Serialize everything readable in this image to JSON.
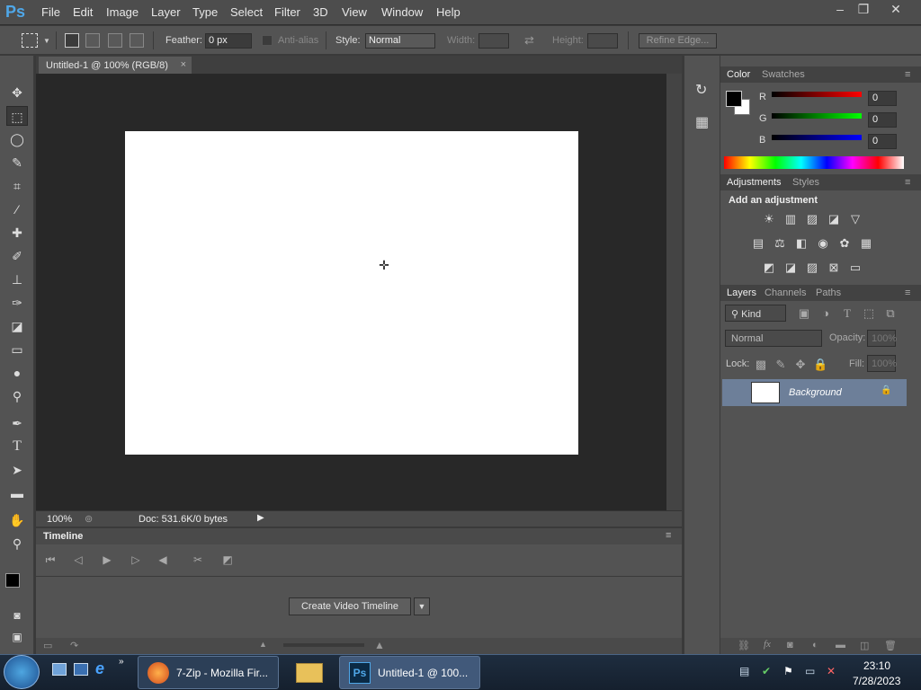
{
  "app": {
    "logo": "Ps"
  },
  "menu": [
    "File",
    "Edit",
    "Image",
    "Layer",
    "Type",
    "Select",
    "Filter",
    "3D",
    "View",
    "Window",
    "Help"
  ],
  "window_controls": {
    "minimize": "‒",
    "restore": "❐",
    "close": "✕"
  },
  "options": {
    "feather_label": "Feather:",
    "feather_value": "0 px",
    "antialias_label": "Anti-alias",
    "style_label": "Style:",
    "style_value": "Normal",
    "width_label": "Width:",
    "height_label": "Height:",
    "refine_edge": "Refine Edge..."
  },
  "document": {
    "tab_title": "Untitled-1 @ 100% (RGB/8)",
    "tab_close": "×",
    "zoom": "100%",
    "doc_info": "Doc: 531.6K/0 bytes"
  },
  "timeline": {
    "title": "Timeline",
    "create_button": "Create Video Timeline"
  },
  "color_panel": {
    "tabs": [
      "Color",
      "Swatches"
    ],
    "channels": [
      {
        "label": "R",
        "value": "0"
      },
      {
        "label": "G",
        "value": "0"
      },
      {
        "label": "B",
        "value": "0"
      }
    ]
  },
  "adjustments_panel": {
    "tabs": [
      "Adjustments",
      "Styles"
    ],
    "heading": "Add an adjustment"
  },
  "layers_panel": {
    "tabs": [
      "Layers",
      "Channels",
      "Paths"
    ],
    "filter_kind": "Kind",
    "blend_mode": "Normal",
    "opacity_label": "Opacity:",
    "opacity_value": "100%",
    "lock_label": "Lock:",
    "fill_label": "Fill:",
    "fill_value": "100%",
    "layer_name": "Background"
  },
  "taskbar": {
    "apps": [
      {
        "label": "7-Zip - Mozilla Fir..."
      },
      {
        "label": "Untitled-1 @ 100..."
      }
    ],
    "time": "23:10",
    "date": "7/28/2023"
  },
  "colors": {
    "accent": "#4fa7e8",
    "canvas": "#ffffff",
    "selected_layer": "#6d7f99"
  }
}
